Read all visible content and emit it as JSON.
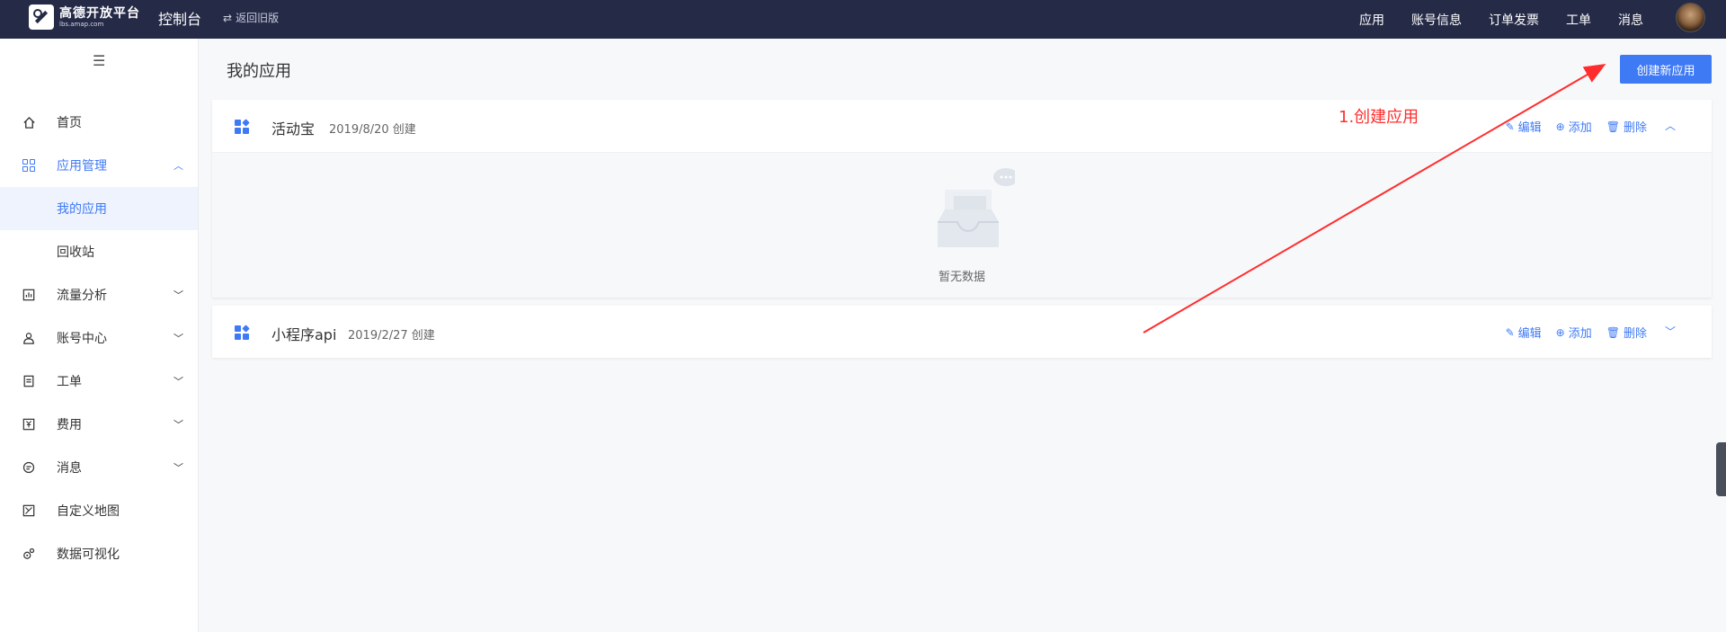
{
  "header": {
    "logo_title": "高德开放平台",
    "logo_sub": "lbs.amap.com",
    "console": "控制台",
    "back_old": "返回旧版",
    "nav": [
      "应用",
      "账号信息",
      "订单发票",
      "工单",
      "消息"
    ]
  },
  "sidebar": {
    "items": [
      {
        "label": "首页",
        "icon": "home-icon"
      },
      {
        "label": "应用管理",
        "icon": "grid-icon"
      },
      {
        "label": "我的应用"
      },
      {
        "label": "回收站"
      },
      {
        "label": "流量分析",
        "icon": "chart-icon"
      },
      {
        "label": "账号中心",
        "icon": "user-icon"
      },
      {
        "label": "工单",
        "icon": "clipboard-icon"
      },
      {
        "label": "费用",
        "icon": "money-icon"
      },
      {
        "label": "消息",
        "icon": "message-icon"
      },
      {
        "label": "自定义地图",
        "icon": "map-edit-icon"
      },
      {
        "label": "数据可视化",
        "icon": "visualization-icon"
      }
    ]
  },
  "main": {
    "title": "我的应用",
    "create_button": "创建新应用",
    "apps": [
      {
        "name": "活动宝",
        "date": "2019/8/20 创建",
        "expanded": true,
        "empty_text": "暂无数据"
      },
      {
        "name": "小程序api",
        "date": "2019/2/27 创建",
        "expanded": false
      }
    ],
    "actions": {
      "edit": "编辑",
      "add": "添加",
      "delete": "删除"
    }
  },
  "annotation": {
    "text": "1.创建应用",
    "color": "#ff2d2d"
  },
  "colors": {
    "topbar": "#252a47",
    "accent": "#3f7af5"
  }
}
